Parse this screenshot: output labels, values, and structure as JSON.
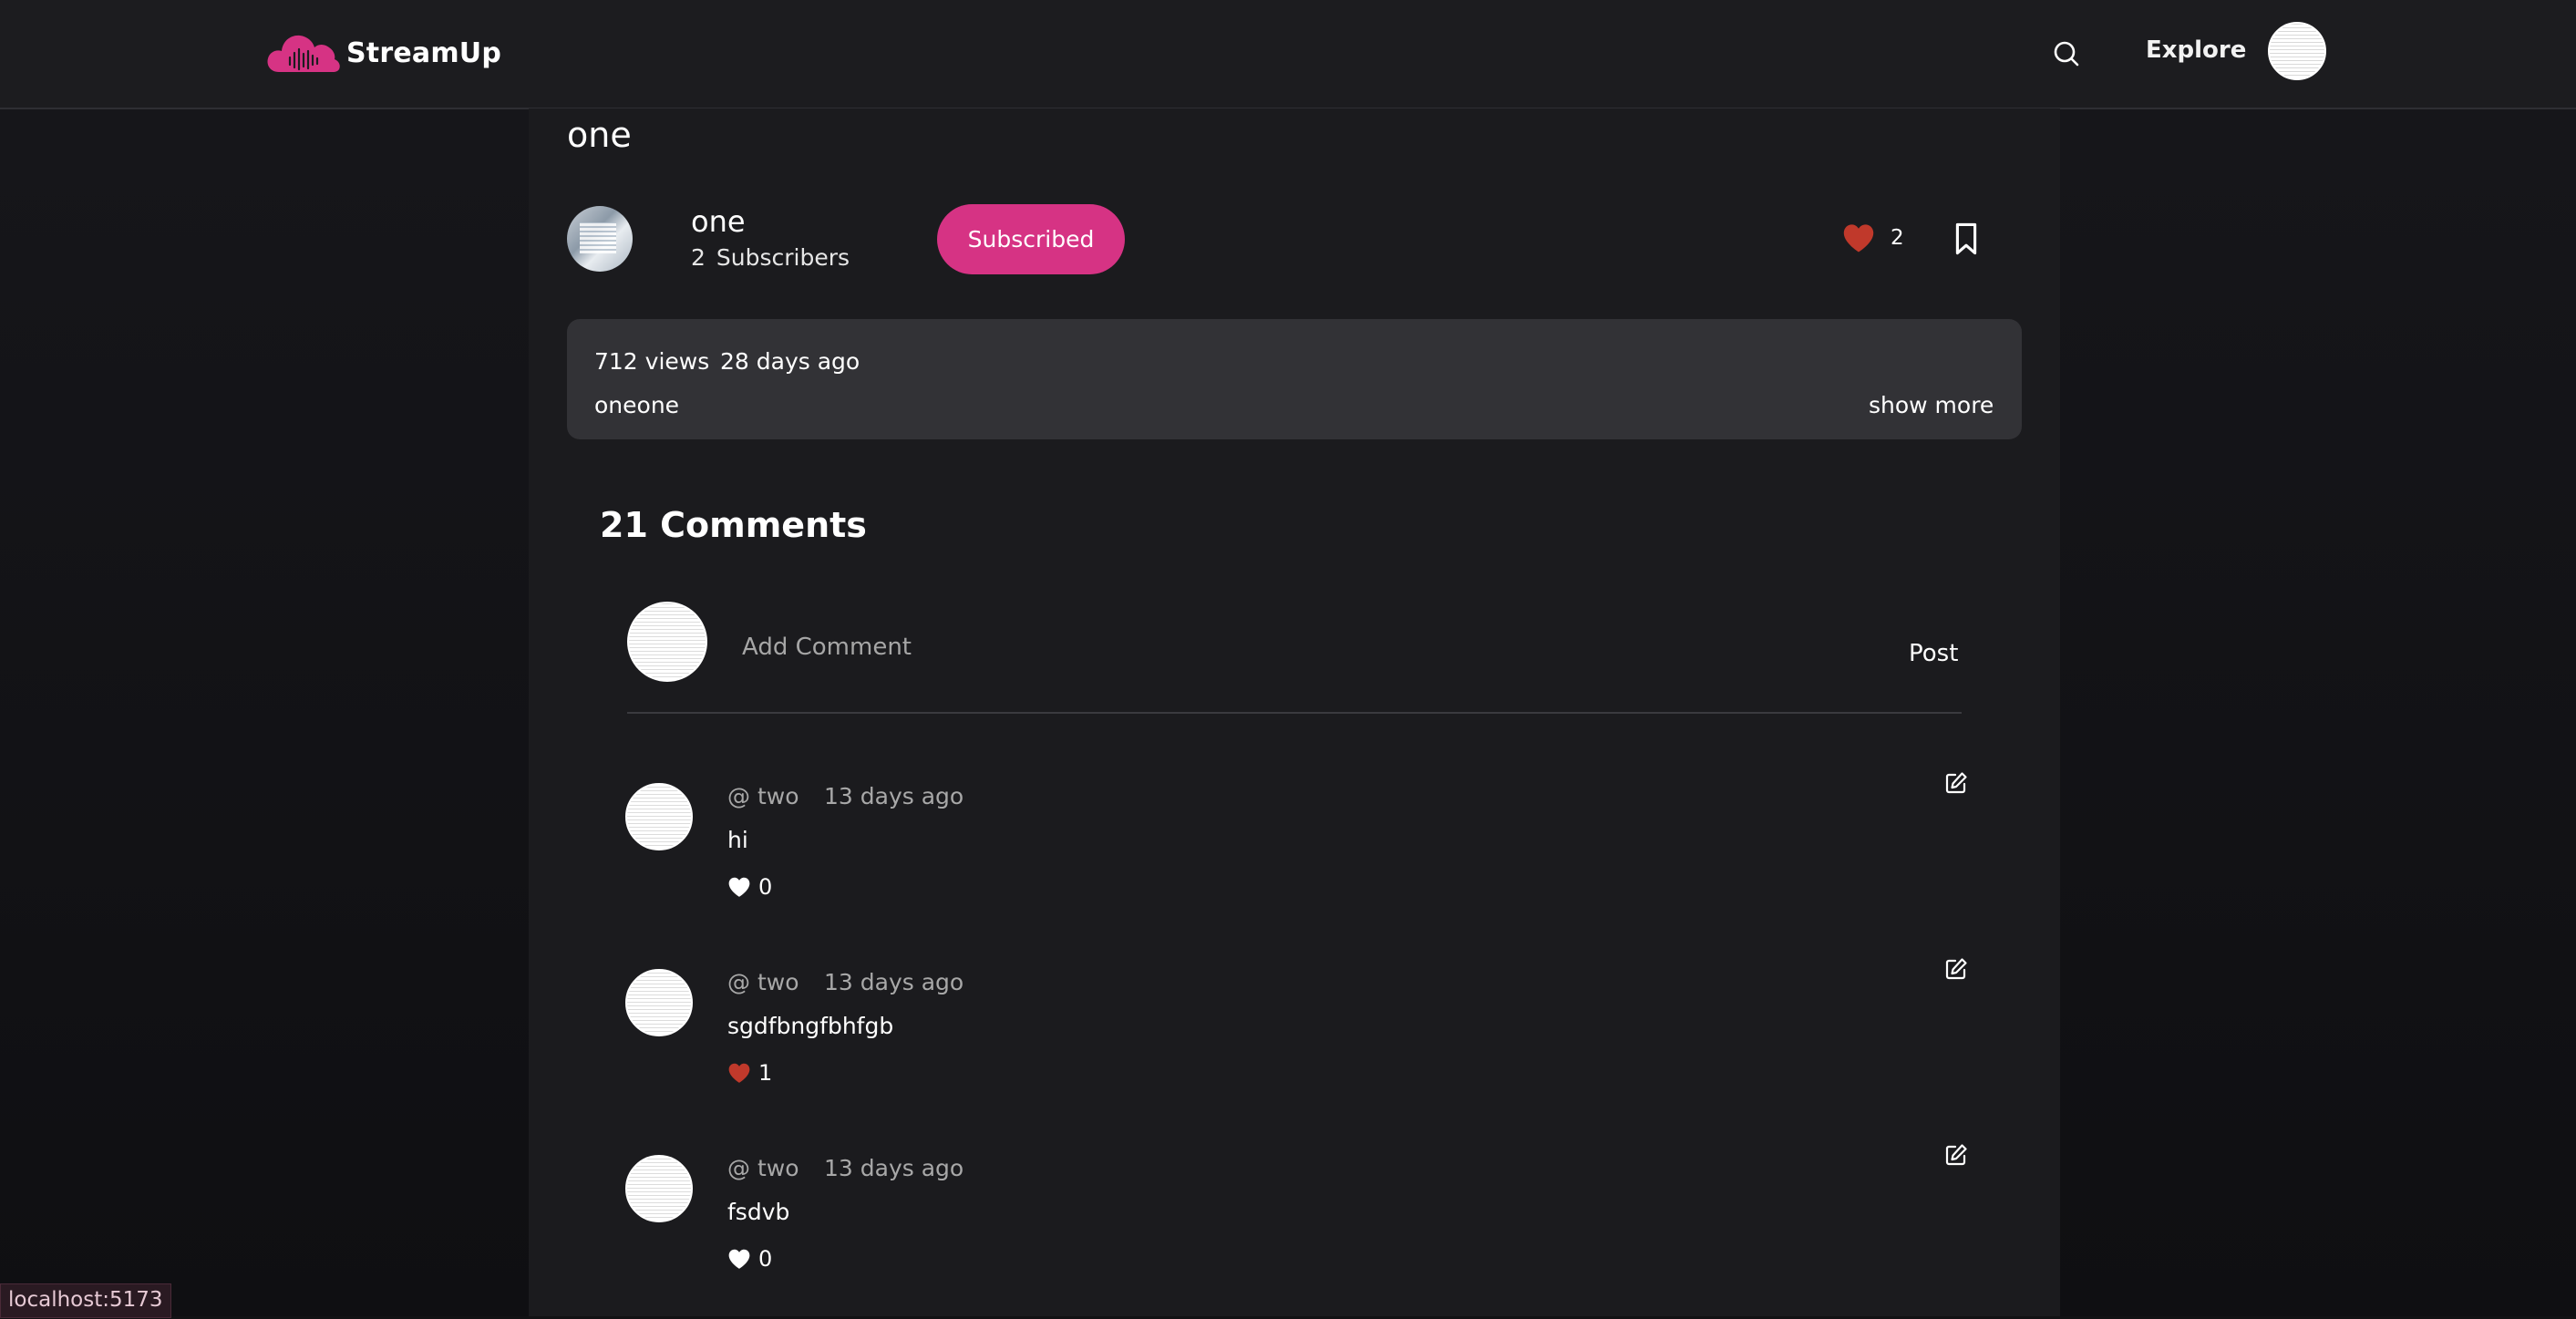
{
  "header": {
    "brand": "StreamUp",
    "explore_label": "Explore",
    "icons": {
      "search": "search-icon",
      "logo": "cloud-waveform-icon"
    },
    "brand_color": "#d63384"
  },
  "video": {
    "title": "one",
    "channel": {
      "name": "one",
      "subscriber_count": "2",
      "subscriber_label": "Subscribers"
    },
    "subscribe_label": "Subscribed",
    "likes": "2",
    "like_color": "#c0392b",
    "views": "712 views",
    "uploaded": "28 days ago",
    "description": "oneone",
    "show_more_label": "show more"
  },
  "comments": {
    "title": "21 Comments",
    "input_placeholder": "Add Comment",
    "post_label": "Post",
    "items": [
      {
        "user": "@ two",
        "time": "13 days ago",
        "text": "hi",
        "likes": "0",
        "liked": false
      },
      {
        "user": "@ two",
        "time": "13 days ago",
        "text": "sgdfbngfbhfgb",
        "likes": "1",
        "liked": true
      },
      {
        "user": "@ two",
        "time": "13 days ago",
        "text": "fsdvb",
        "likes": "0",
        "liked": false
      }
    ]
  },
  "status_bar": {
    "url": "localhost:5173"
  }
}
